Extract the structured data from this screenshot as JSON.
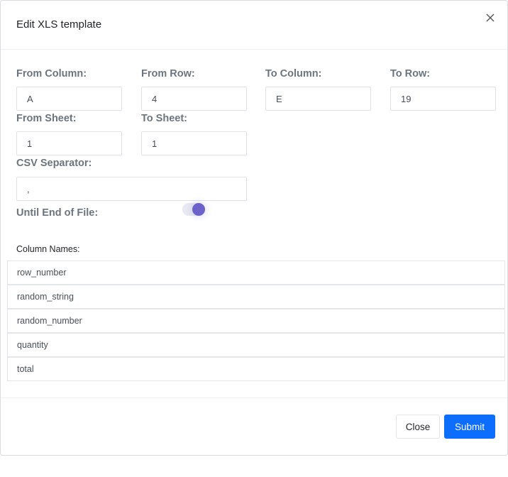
{
  "modal": {
    "title": "Edit XLS template",
    "close_icon": "close-icon"
  },
  "form": {
    "from_column": {
      "label": "From Column:",
      "value": "A"
    },
    "from_row": {
      "label": "From Row:",
      "value": "4"
    },
    "to_column": {
      "label": "To Column:",
      "value": "E"
    },
    "to_row": {
      "label": "To Row:",
      "value": "19"
    },
    "from_sheet": {
      "label": "From Sheet:",
      "value": "1"
    },
    "to_sheet": {
      "label": "To Sheet:",
      "value": "1"
    },
    "csv_separator": {
      "label": "CSV Separator:",
      "value": ","
    },
    "until_eof": {
      "label": "Until End of File:",
      "enabled": true
    }
  },
  "column_names": {
    "label": "Column Names:",
    "items": [
      "row_number",
      "random_string",
      "random_number",
      "quantity",
      "total"
    ]
  },
  "footer": {
    "close_label": "Close",
    "submit_label": "Submit"
  },
  "colors": {
    "primary": "#0d6efd",
    "toggle_on": "#6b63c9"
  }
}
